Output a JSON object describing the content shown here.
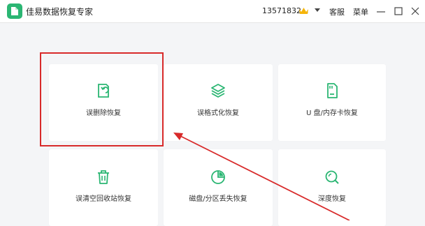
{
  "window": {
    "title": "佳易数据恢复专家",
    "user_account": "13571832...",
    "service_label": "客服",
    "menu_label": "菜单"
  },
  "cards": [
    {
      "label": "误删除恢复",
      "icon": "deleted-file-restore-icon"
    },
    {
      "label": "误格式化恢复",
      "icon": "layers-icon"
    },
    {
      "label": "U 盘/内存卡恢复",
      "icon": "sd-card-icon"
    },
    {
      "label": "误清空回收站恢复",
      "icon": "trash-icon"
    },
    {
      "label": "磁盘/分区丢失恢复",
      "icon": "disk-partition-icon"
    },
    {
      "label": "深度恢复",
      "icon": "deep-search-icon"
    }
  ],
  "colors": {
    "accent": "#2bb673",
    "highlight": "#d82a2a",
    "background": "#f4f5f7"
  }
}
